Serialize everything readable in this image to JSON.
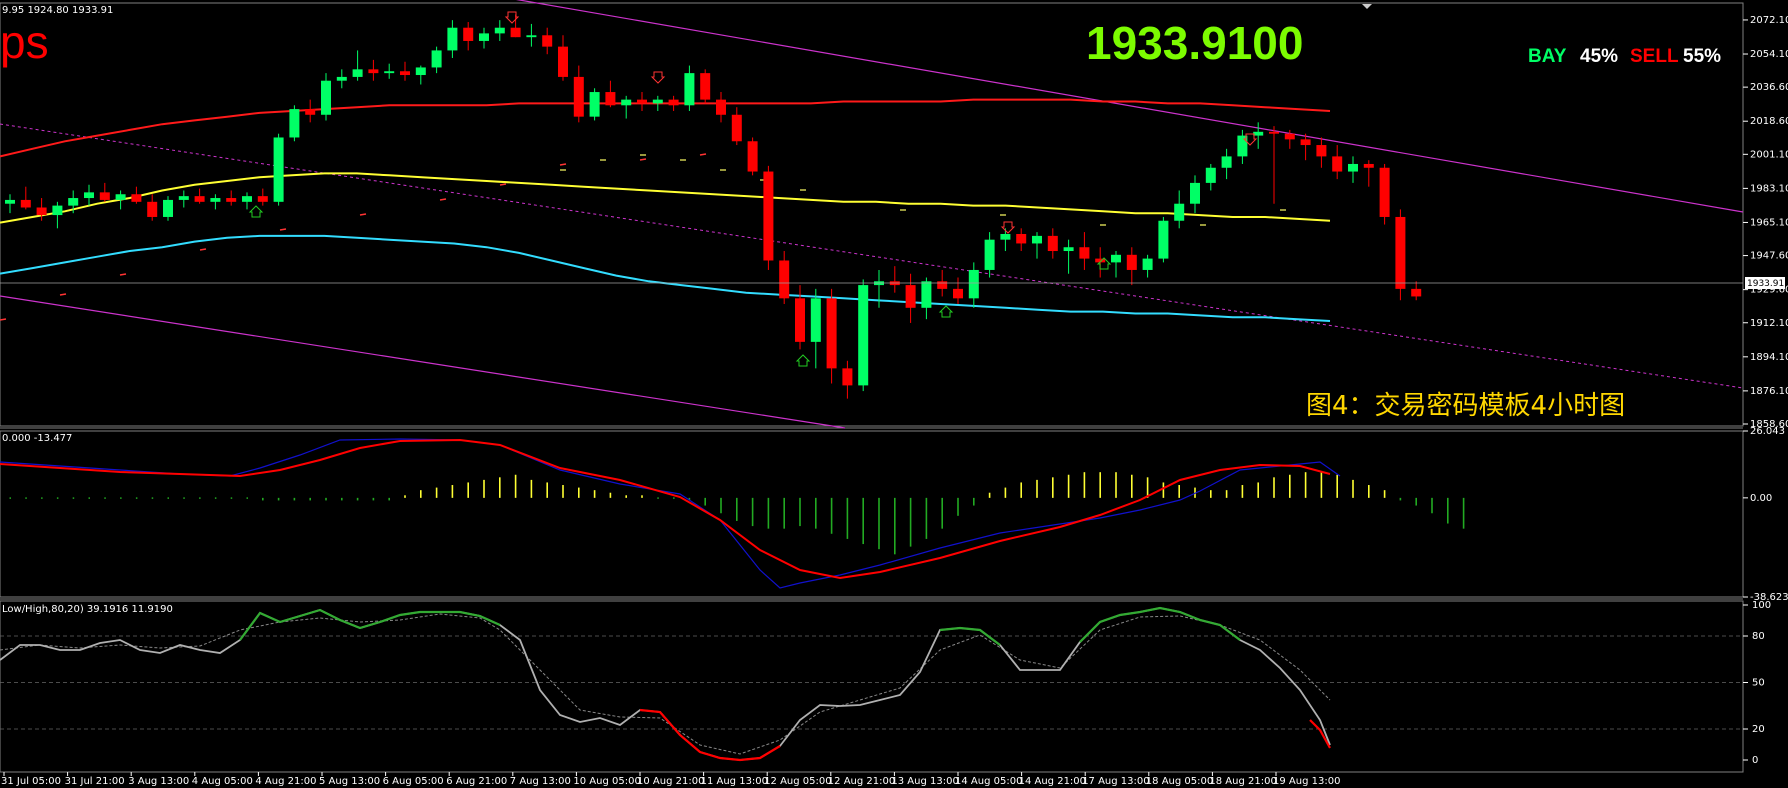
{
  "header": {
    "ohlc_text": "9.95 1924.80 1933.91",
    "ps_text": "ps",
    "big_price": "1933.9100",
    "bay_label": "BAY",
    "bay_pct": "45%",
    "sell_label": "SELL",
    "sell_pct": "55%",
    "caption": "图4：交易密码模板4小时图",
    "current_price_tag": "1933.91"
  },
  "panels": {
    "macd_label": "0.000 -13.477",
    "stoch_label": "Low/High,80,20) 39.1916 11.9190"
  },
  "colors": {
    "bull": "#00ff66",
    "bear": "#ff0000",
    "ma_red": "#ff1a1a",
    "ma_yellow": "#ffff33",
    "ma_cyan": "#33ddff",
    "channel": "#cc33cc",
    "macd_signal": "#ff0000",
    "macd_main": "#1111cc",
    "hist_pos": "#ffff33",
    "hist_neg": "#22aa22",
    "stoch_main": "#b0b0b0",
    "stoch_ob": "#33aa33",
    "stoch_os": "#ff0000"
  },
  "chart_data": [
    {
      "type": "candlestick",
      "price_ticks": [
        "2072.10",
        "2054.10",
        "2036.60",
        "2018.60",
        "2001.10",
        "1983.10",
        "1965.10",
        "1947.60",
        "1929.60",
        "1912.10",
        "1894.10",
        "1876.10",
        "1858.60"
      ],
      "ylim": [
        1858.6,
        2080
      ],
      "time_labels": [
        "31 Jul 05:00",
        "31 Jul 21:00",
        "3 Aug 13:00",
        "4 Aug 05:00",
        "4 Aug 21:00",
        "5 Aug 13:00",
        "6 Aug 05:00",
        "6 Aug 21:00",
        "7 Aug 13:00",
        "10 Aug 05:00",
        "10 Aug 21:00",
        "11 Aug 13:00",
        "12 Aug 05:00",
        "12 Aug 21:00",
        "13 Aug 13:00",
        "14 Aug 05:00",
        "14 Aug 21:00",
        "17 Aug 13:00",
        "18 Aug 05:00",
        "18 Aug 21:00",
        "19 Aug 13:00"
      ],
      "candles": [
        [
          1975,
          1980,
          1970,
          1977
        ],
        [
          1977,
          1984,
          1972,
          1973
        ],
        [
          1973,
          1978,
          1966,
          1969
        ],
        [
          1969,
          1976,
          1962,
          1974
        ],
        [
          1974,
          1982,
          1970,
          1978
        ],
        [
          1978,
          1985,
          1974,
          1981
        ],
        [
          1981,
          1986,
          1976,
          1977
        ],
        [
          1977,
          1982,
          1972,
          1980
        ],
        [
          1980,
          1984,
          1975,
          1976
        ],
        [
          1976,
          1980,
          1966,
          1968
        ],
        [
          1968,
          1979,
          1966,
          1977
        ],
        [
          1977,
          1982,
          1973,
          1979
        ],
        [
          1979,
          1983,
          1975,
          1976
        ],
        [
          1976,
          1980,
          1972,
          1978
        ],
        [
          1978,
          1982,
          1974,
          1976
        ],
        [
          1976,
          1981,
          1972,
          1979
        ],
        [
          1979,
          1983,
          1974,
          1976
        ],
        [
          1976,
          2012,
          1974,
          2010
        ],
        [
          2010,
          2027,
          2008,
          2025
        ],
        [
          2025,
          2030,
          2018,
          2022
        ],
        [
          2022,
          2044,
          2019,
          2040
        ],
        [
          2040,
          2046,
          2036,
          2042
        ],
        [
          2042,
          2056,
          2040,
          2046
        ],
        [
          2046,
          2051,
          2040,
          2044
        ],
        [
          2044,
          2049,
          2041,
          2045
        ],
        [
          2045,
          2050,
          2040,
          2043
        ],
        [
          2043,
          2048,
          2038,
          2047
        ],
        [
          2047,
          2058,
          2044,
          2056
        ],
        [
          2056,
          2072,
          2052,
          2068
        ],
        [
          2068,
          2071,
          2056,
          2061
        ],
        [
          2061,
          2068,
          2057,
          2065
        ],
        [
          2065,
          2072,
          2061,
          2068
        ],
        [
          2068,
          2075,
          2063,
          2063
        ],
        [
          2063,
          2070,
          2058,
          2064
        ],
        [
          2064,
          2068,
          2054,
          2058
        ],
        [
          2058,
          2064,
          2040,
          2042
        ],
        [
          2042,
          2048,
          2018,
          2021
        ],
        [
          2021,
          2036,
          2019,
          2034
        ],
        [
          2034,
          2040,
          2026,
          2027
        ],
        [
          2027,
          2032,
          2020,
          2030
        ],
        [
          2030,
          2034,
          2024,
          2028
        ],
        [
          2028,
          2032,
          2024,
          2030
        ],
        [
          2030,
          2032,
          2024,
          2027
        ],
        [
          2027,
          2048,
          2024,
          2044
        ],
        [
          2044,
          2046,
          2028,
          2030
        ],
        [
          2030,
          2034,
          2018,
          2022
        ],
        [
          2022,
          2026,
          2006,
          2008
        ],
        [
          2008,
          2010,
          1990,
          1992
        ],
        [
          1992,
          1995,
          1940,
          1945
        ],
        [
          1945,
          1950,
          1922,
          1925
        ],
        [
          1925,
          1932,
          1898,
          1902
        ],
        [
          1902,
          1930,
          1888,
          1925
        ],
        [
          1925,
          1930,
          1880,
          1888
        ],
        [
          1888,
          1892,
          1872,
          1879
        ],
        [
          1879,
          1935,
          1876,
          1932
        ],
        [
          1932,
          1940,
          1920,
          1934
        ],
        [
          1934,
          1942,
          1928,
          1932
        ],
        [
          1932,
          1938,
          1912,
          1920
        ],
        [
          1920,
          1936,
          1914,
          1934
        ],
        [
          1934,
          1940,
          1926,
          1930
        ],
        [
          1930,
          1936,
          1922,
          1925
        ],
        [
          1925,
          1944,
          1920,
          1940
        ],
        [
          1940,
          1960,
          1936,
          1956
        ],
        [
          1956,
          1962,
          1950,
          1959
        ],
        [
          1959,
          1962,
          1950,
          1954
        ],
        [
          1954,
          1960,
          1946,
          1958
        ],
        [
          1958,
          1962,
          1946,
          1950
        ],
        [
          1950,
          1956,
          1938,
          1952
        ],
        [
          1952,
          1960,
          1940,
          1946
        ],
        [
          1946,
          1952,
          1936,
          1944
        ],
        [
          1944,
          1950,
          1936,
          1948
        ],
        [
          1948,
          1952,
          1932,
          1940
        ],
        [
          1940,
          1948,
          1936,
          1946
        ],
        [
          1946,
          1968,
          1944,
          1966
        ],
        [
          1966,
          1982,
          1962,
          1975
        ],
        [
          1975,
          1990,
          1970,
          1986
        ],
        [
          1986,
          1996,
          1982,
          1994
        ],
        [
          1994,
          2004,
          1988,
          2000
        ],
        [
          2000,
          2014,
          1996,
          2011
        ],
        [
          2011,
          2018,
          2004,
          2013
        ],
        [
          2013,
          2016,
          1975,
          2012
        ],
        [
          2012,
          2014,
          2004,
          2009
        ],
        [
          2009,
          2012,
          1998,
          2006
        ],
        [
          2006,
          2010,
          1994,
          2000
        ],
        [
          2000,
          2006,
          1988,
          1992
        ],
        [
          1992,
          2000,
          1986,
          1996
        ],
        [
          1996,
          1998,
          1984,
          1994
        ],
        [
          1994,
          1996,
          1964,
          1968
        ],
        [
          1968,
          1972,
          1924,
          1930
        ],
        [
          1930,
          1934,
          1924,
          1926
        ]
      ],
      "ma_red": [
        2000,
        2004,
        2008,
        2011,
        2014,
        2017,
        2019,
        2021,
        2023,
        2024,
        2025,
        2026,
        2027,
        2027,
        2027,
        2027,
        2028,
        2028,
        2028,
        2028,
        2028,
        2028,
        2028,
        2028,
        2028,
        2028,
        2029,
        2029,
        2029,
        2029,
        2030,
        2030,
        2030,
        2030,
        2029,
        2029,
        2028,
        2028,
        2027,
        2026,
        2025,
        2024
      ],
      "ma_yellow": [
        1965,
        1968,
        1971,
        1975,
        1978,
        1982,
        1985,
        1987,
        1989,
        1990,
        1991,
        1991,
        1990,
        1989,
        1988,
        1987,
        1986,
        1985,
        1984,
        1983,
        1982,
        1981,
        1980,
        1979,
        1978,
        1977,
        1976,
        1976,
        1975,
        1975,
        1974,
        1974,
        1973,
        1972,
        1971,
        1970,
        1970,
        1969,
        1968,
        1968,
        1967,
        1966
      ],
      "ma_cyan": [
        1938,
        1941,
        1944,
        1947,
        1950,
        1952,
        1955,
        1957,
        1958,
        1958,
        1958,
        1957,
        1956,
        1955,
        1954,
        1952,
        1949,
        1945,
        1941,
        1937,
        1934,
        1932,
        1930,
        1928,
        1927,
        1926,
        1925,
        1924,
        1923,
        1922,
        1921,
        1920,
        1919,
        1918,
        1918,
        1917,
        1917,
        1916,
        1915,
        1915,
        1914,
        1913
      ]
    },
    {
      "type": "bar",
      "name": "macd_histogram",
      "ylim": [
        -38.623,
        26.043
      ],
      "ticks": [
        "26.043",
        "0.00",
        "-38.623"
      ],
      "values": [
        0,
        0,
        0,
        0,
        0,
        0,
        0,
        0,
        0,
        0,
        0,
        0,
        0,
        0,
        0,
        0,
        -1,
        -1,
        -1,
        -1,
        -1,
        -1,
        -1,
        -1,
        -1,
        1,
        3,
        4,
        5,
        6,
        7,
        8,
        9,
        7,
        6,
        5,
        4,
        3,
        2,
        1,
        1,
        0,
        0,
        -1,
        -3,
        -6,
        -9,
        -11,
        -12,
        -12,
        -11,
        -12,
        -14,
        -16,
        -18,
        -20,
        -22,
        -19,
        -16,
        -12,
        -7,
        -3,
        2,
        4,
        6,
        7,
        8,
        9,
        10,
        10,
        10,
        9,
        8,
        6,
        5,
        4,
        3,
        3,
        5,
        6,
        8,
        9,
        10,
        10,
        9,
        7,
        5,
        3,
        -1,
        -3,
        -6,
        -10,
        -12
      ]
    },
    {
      "type": "line",
      "name": "stochastic",
      "ylim": [
        0,
        100
      ],
      "ticks": [
        "100",
        "80",
        "50",
        "20",
        "0"
      ],
      "levels": [
        80,
        50,
        20
      ]
    }
  ]
}
